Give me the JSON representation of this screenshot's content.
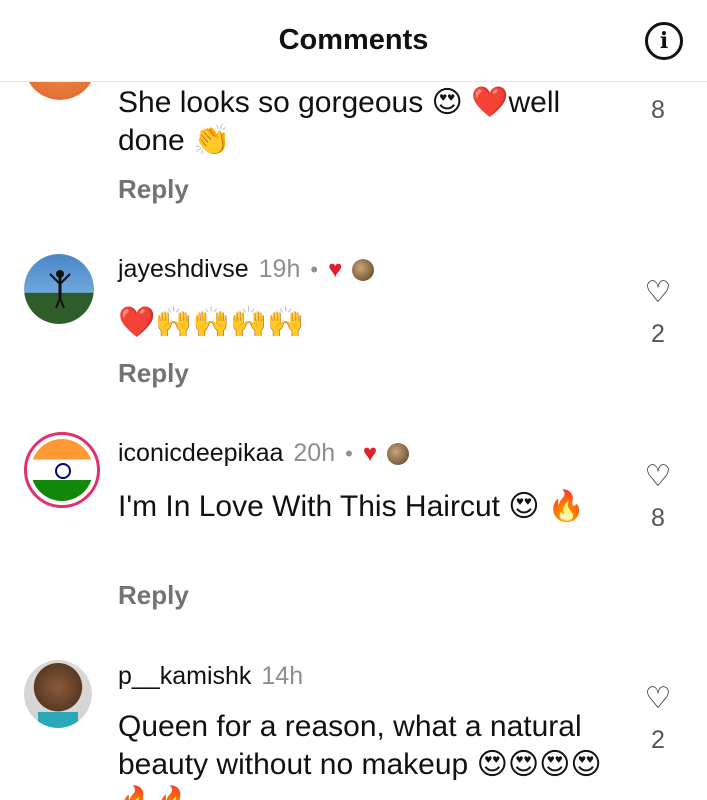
{
  "header": {
    "title": "Comments",
    "info_icon": "info-icon"
  },
  "comments": [
    {
      "username": "",
      "time": "",
      "text": "She looks so gorgeous 😍 ❤️well done 👏",
      "reply": "Reply",
      "likes": "8"
    },
    {
      "username": "jayeshdivse",
      "time": "19h",
      "text": "❤️🙌🙌🙌🙌",
      "reply": "Reply",
      "likes": "2"
    },
    {
      "username": "iconicdeepikaa",
      "time": "20h",
      "text": "I'm In Love With This Haircut 😍 🔥",
      "reply": "Reply",
      "likes": "8"
    },
    {
      "username": "p__kamishk",
      "time": "14h",
      "text": "Queen for a reason, what a natural beauty without no makeup 😍😍😍😍🔥🔥",
      "likes": "2"
    }
  ],
  "colors": {
    "like_heart": "#e0202a",
    "story_ring": "#e1306c",
    "secondary_text": "#8e8e8e"
  }
}
